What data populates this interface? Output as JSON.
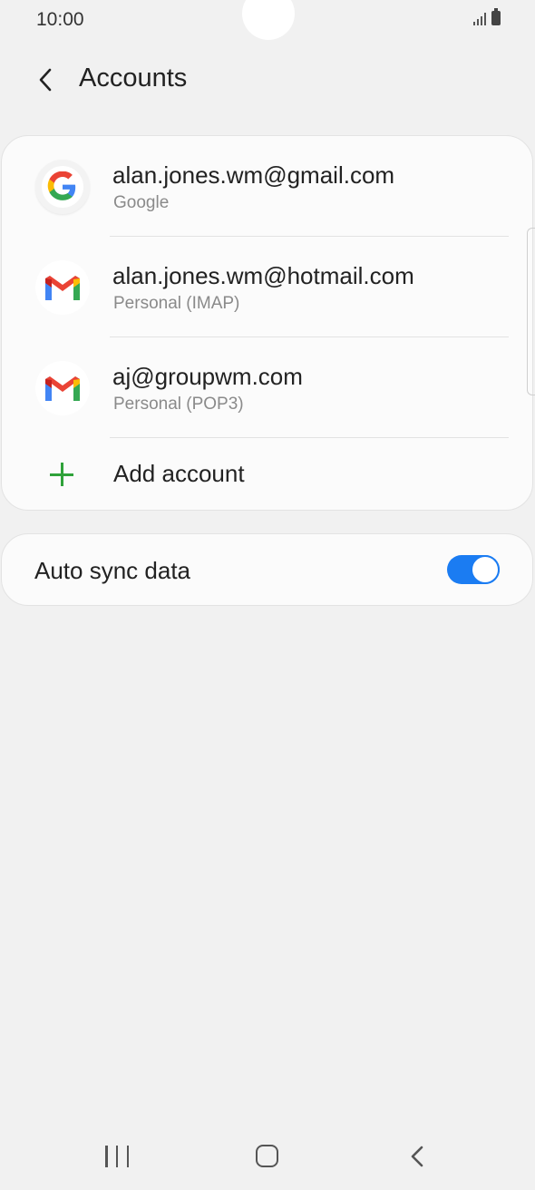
{
  "status_bar": {
    "time": "10:00"
  },
  "header": {
    "title": "Accounts",
    "back_icon": "chevron-left-icon"
  },
  "accounts": [
    {
      "email": "alan.jones.wm@gmail.com",
      "type": "Google",
      "icon": "google-icon"
    },
    {
      "email": "alan.jones.wm@hotmail.com",
      "type": "Personal (IMAP)",
      "icon": "gmail-icon"
    },
    {
      "email": "aj@groupwm.com",
      "type": "Personal (POP3)",
      "icon": "gmail-icon"
    }
  ],
  "add_account": {
    "label": "Add account",
    "icon": "plus-icon"
  },
  "auto_sync": {
    "label": "Auto sync data",
    "enabled": true
  },
  "colors": {
    "background": "#f1f1f1",
    "card": "#fbfbfb",
    "accent_blue": "#1b7cf2",
    "add_green": "#2fa23a",
    "secondary_text": "#8a8a8a"
  },
  "nav_bar": {
    "icons": [
      "recents-icon",
      "home-icon",
      "back-icon"
    ]
  }
}
